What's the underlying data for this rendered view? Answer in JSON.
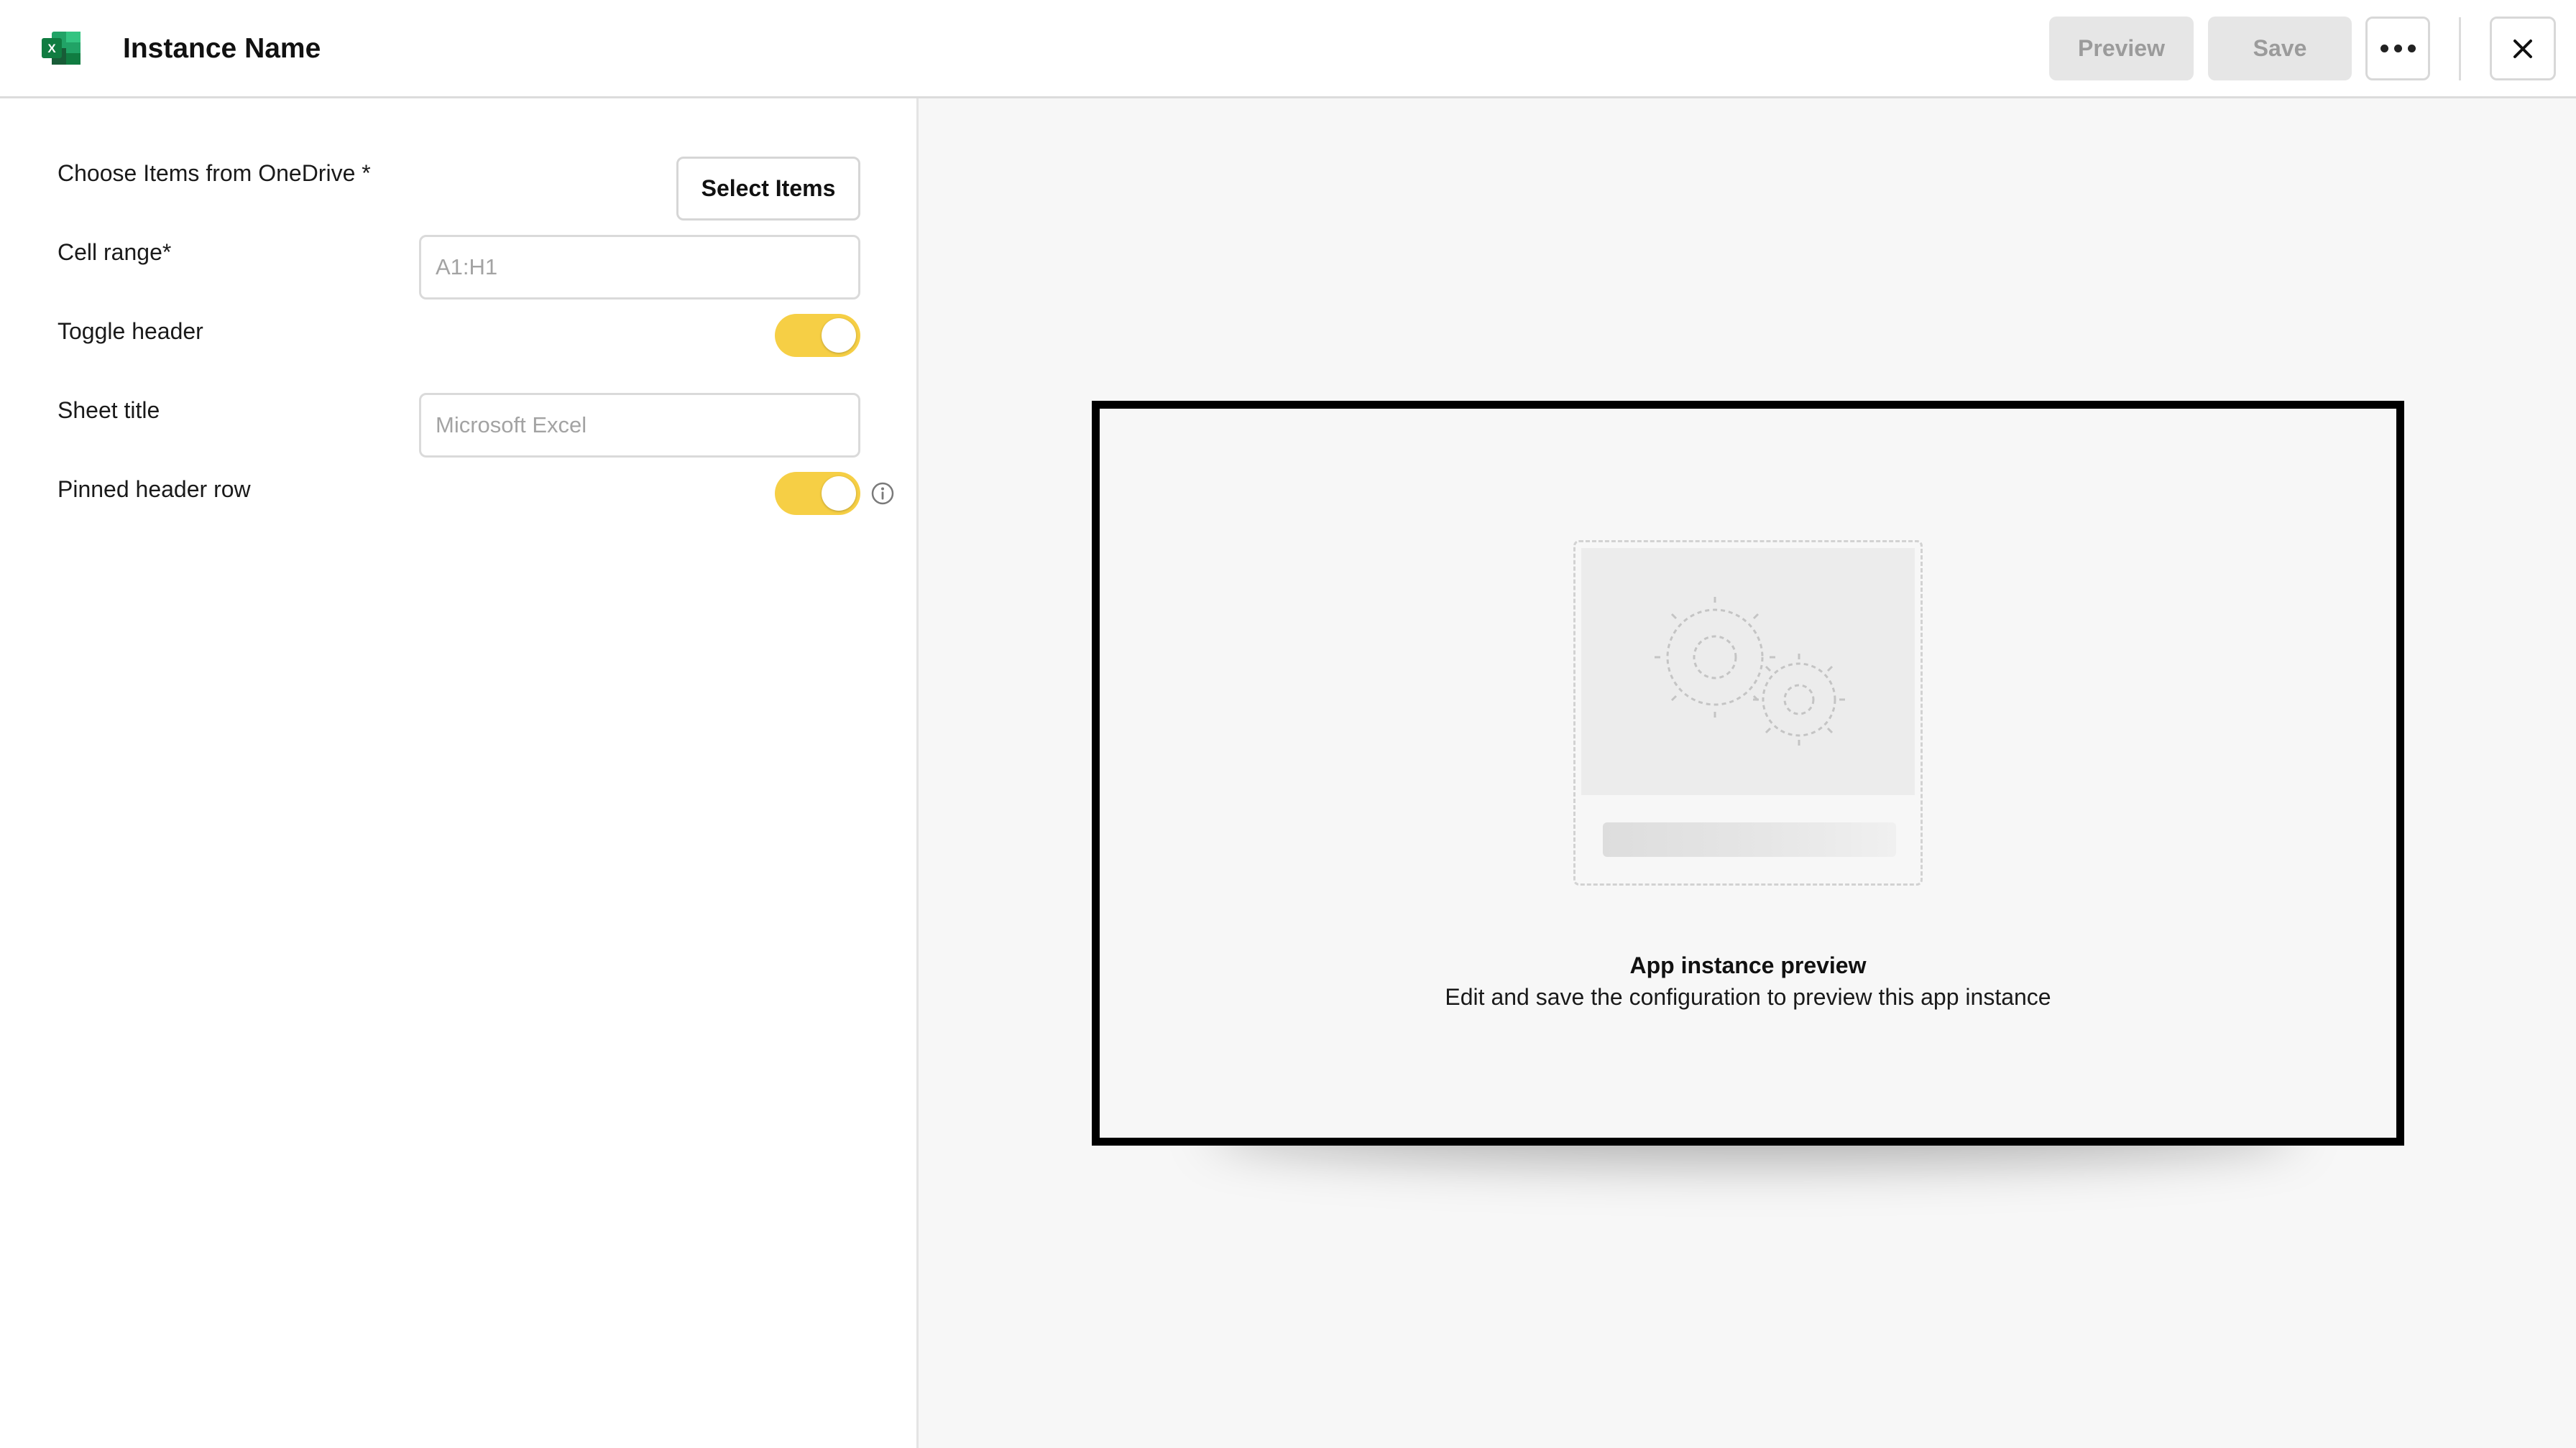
{
  "header": {
    "title": "Instance Name",
    "app_icon": "microsoft-excel-icon",
    "preview_label": "Preview",
    "save_label": "Save",
    "more_icon": "more-horizontal-icon",
    "close_icon": "close-icon"
  },
  "form": {
    "onedrive": {
      "label": "Choose Items from OneDrive *",
      "button_label": "Select Items"
    },
    "cell_range": {
      "label": "Cell range*",
      "value": "",
      "placeholder": "A1:H1"
    },
    "toggle_header": {
      "label": "Toggle header",
      "on": true
    },
    "sheet_title": {
      "label": "Sheet title",
      "value": "",
      "placeholder": "Microsoft Excel"
    },
    "pinned_header_row": {
      "label": "Pinned header row",
      "on": true,
      "info_icon": "info-icon"
    }
  },
  "preview": {
    "title": "App instance preview",
    "subtitle": "Edit and save the configuration to preview this app instance",
    "illustration_icon": "gears-icon"
  },
  "colors": {
    "toggle_on": "#f6cf45",
    "panel_background": "#f7f7f7",
    "disabled_button": "#e6e6e6",
    "excel_green": "#1d7044"
  }
}
